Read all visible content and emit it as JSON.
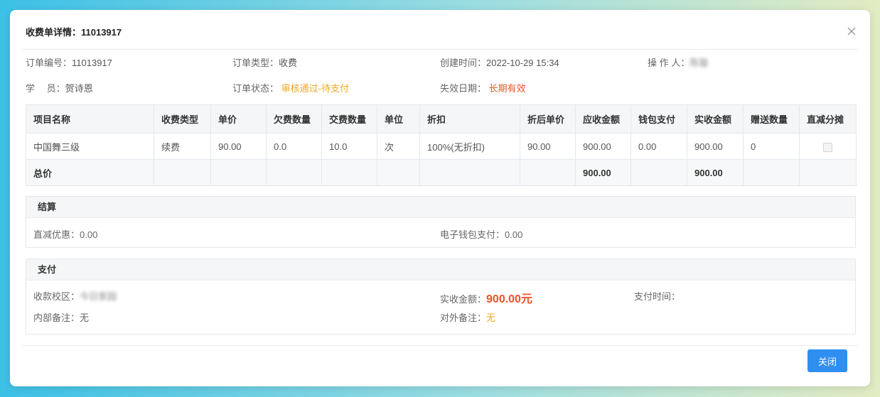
{
  "dialog": {
    "title": "收费单详情：11013917",
    "close_icon": "close-icon"
  },
  "info": {
    "order_no_label": "订单编号：",
    "order_no": "11013917",
    "order_type_label": "订单类型：",
    "order_type": "收费",
    "created_label": "创建时间：",
    "created": "2022-10-29 15:34",
    "operator_label": "操 作 人：",
    "operator": "陈璇",
    "student_label": "学　 员：",
    "student": "贺诗恩",
    "status_label": "订单状态：",
    "status": "审核通过-待支付",
    "expiry_label": "失效日期：",
    "expiry": "长期有效"
  },
  "table": {
    "headers": [
      "项目名称",
      "收费类型",
      "单价",
      "欠费数量",
      "交费数量",
      "单位",
      "折扣",
      "折后单价",
      "应收金额",
      "钱包支付",
      "实收金额",
      "赠送数量",
      "直减分摊"
    ],
    "row": [
      "中国舞三级",
      "续费",
      "90.00",
      "0.0",
      "10.0",
      "次",
      "100%(无折扣)",
      "90.00",
      "900.00",
      "0.00",
      "900.00",
      "0"
    ],
    "total_label": "总价",
    "total_receivable": "900.00",
    "total_received": "900.00"
  },
  "settlement": {
    "title": "结算",
    "direct_discount": "直减优惠：0.00",
    "wallet_payment": "电子钱包支付：0.00"
  },
  "payment": {
    "title": "支付",
    "campus_label": "收款校区：",
    "campus": "今日家园",
    "received_label": "实收金额：",
    "received": "900.00元",
    "pay_time_label": "支付时间：",
    "internal_note_label": "内部备注：",
    "internal_note": "无",
    "external_note_label": "对外备注：",
    "external_note": "无"
  },
  "footer": {
    "close_label": "关闭"
  },
  "colors": {
    "primary": "#2f8ff0",
    "status_orange": "#f5a623",
    "accent_red": "#f0512a"
  }
}
